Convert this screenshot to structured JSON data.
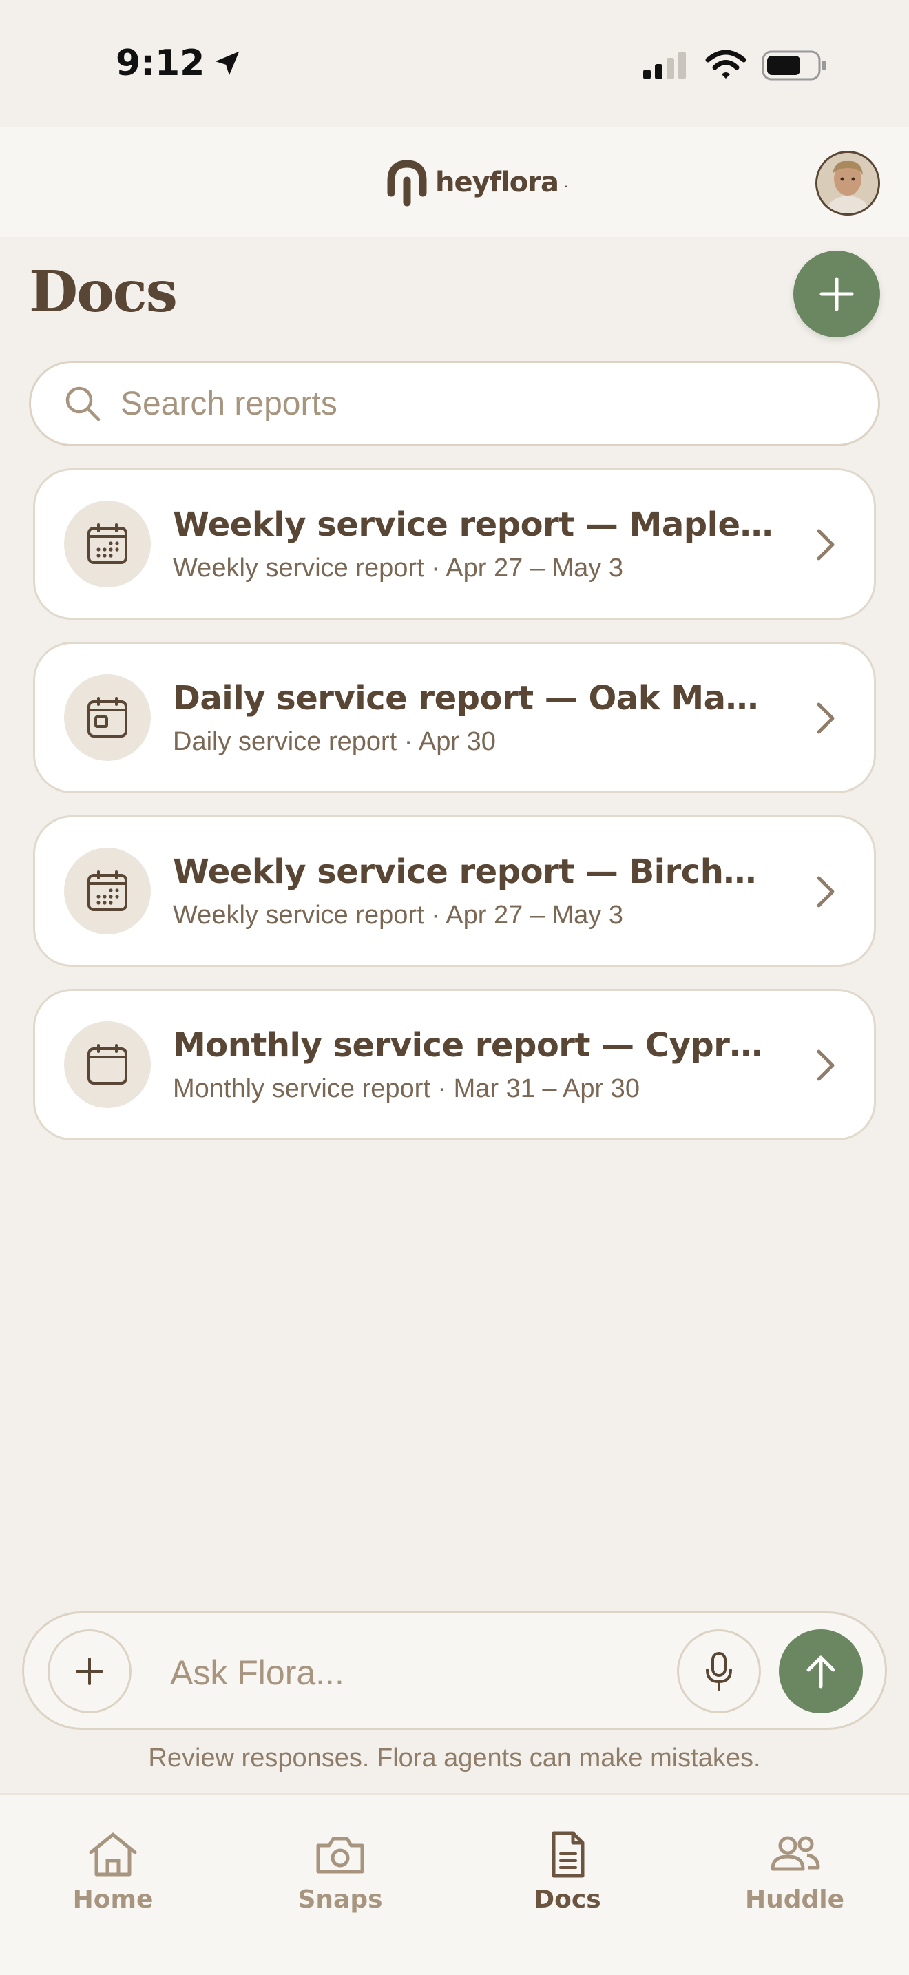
{
  "status_bar": {
    "time": "9:12"
  },
  "header": {
    "logo_text": "heyflora",
    "logo_dot": "."
  },
  "page": {
    "title": "Docs"
  },
  "search": {
    "placeholder": "Search reports",
    "value": ""
  },
  "reports": [
    {
      "title": "Weekly service report — Maple Lane",
      "subtitle": "Weekly service report · Apr 27 – May 3",
      "icon": "calendar-grid-icon"
    },
    {
      "title": "Daily service report — Oak Manor",
      "subtitle": "Daily service report · Apr 30",
      "icon": "calendar-day-icon"
    },
    {
      "title": "Weekly service report — Birchwoo...",
      "subtitle": "Weekly service report · Apr 27 – May 3",
      "icon": "calendar-grid-icon"
    },
    {
      "title": "Monthly service report — Cypress...",
      "subtitle": "Monthly service report · Mar 31 – Apr 30",
      "icon": "calendar-month-icon"
    }
  ],
  "composer": {
    "placeholder": "Ask Flora...",
    "value": "",
    "disclaimer": "Review responses. Flora agents can make mistakes."
  },
  "tabs": [
    {
      "label": "Home",
      "icon": "home-icon",
      "active": false
    },
    {
      "label": "Snaps",
      "icon": "camera-icon",
      "active": false
    },
    {
      "label": "Docs",
      "icon": "document-icon",
      "active": true
    },
    {
      "label": "Huddle",
      "icon": "people-icon",
      "active": false
    }
  ],
  "colors": {
    "background": "#f3f0eb",
    "primary_text": "#5a4634",
    "accent_green": "#6b8761",
    "muted_text": "#a79580",
    "card_border": "#e1d9cc"
  }
}
